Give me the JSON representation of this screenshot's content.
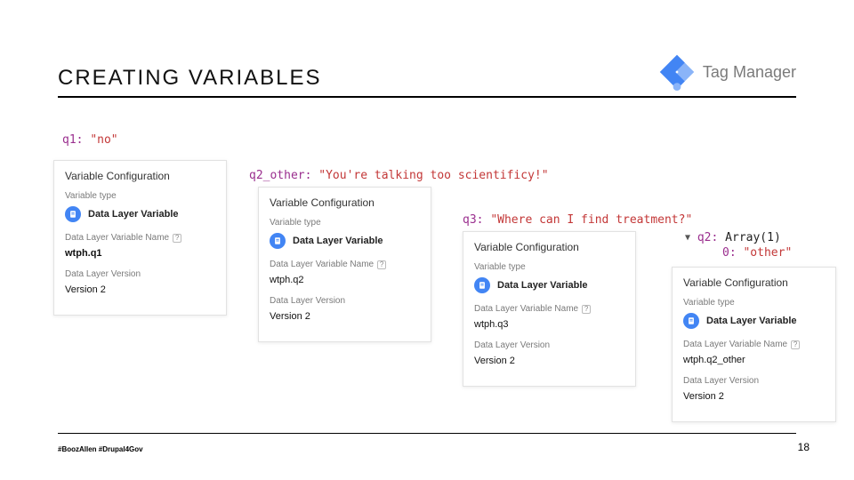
{
  "header": {
    "title": "CREATING VARIABLES",
    "product": "Tag Manager"
  },
  "code": {
    "q1_key": "q1:",
    "q1_val": "\"no\"",
    "q2o_key": "q2_other:",
    "q2o_val": "\"You're talking too scientificy!\"",
    "q3_key": "q3:",
    "q3_val": "\"Where can I find treatment?\"",
    "q2_key": "q2:",
    "q2_arr": "Array(1)",
    "q2_idx": "0:",
    "q2_idx_val": "\"other\""
  },
  "panels": {
    "config_title": "Variable Configuration",
    "type_label": "Variable type",
    "dlv": "Data Layer Variable",
    "name_label": "Data Layer Variable Name",
    "version_label": "Data Layer Version",
    "version_value": "Version 2",
    "names": {
      "p1": "wtph.q1",
      "p2": "wtph.q2",
      "p3": "wtph.q3",
      "p4": "wtph.q2_other"
    }
  },
  "footer": {
    "hashtags": "#BoozAllen #Drupal4Gov",
    "page": "18"
  }
}
